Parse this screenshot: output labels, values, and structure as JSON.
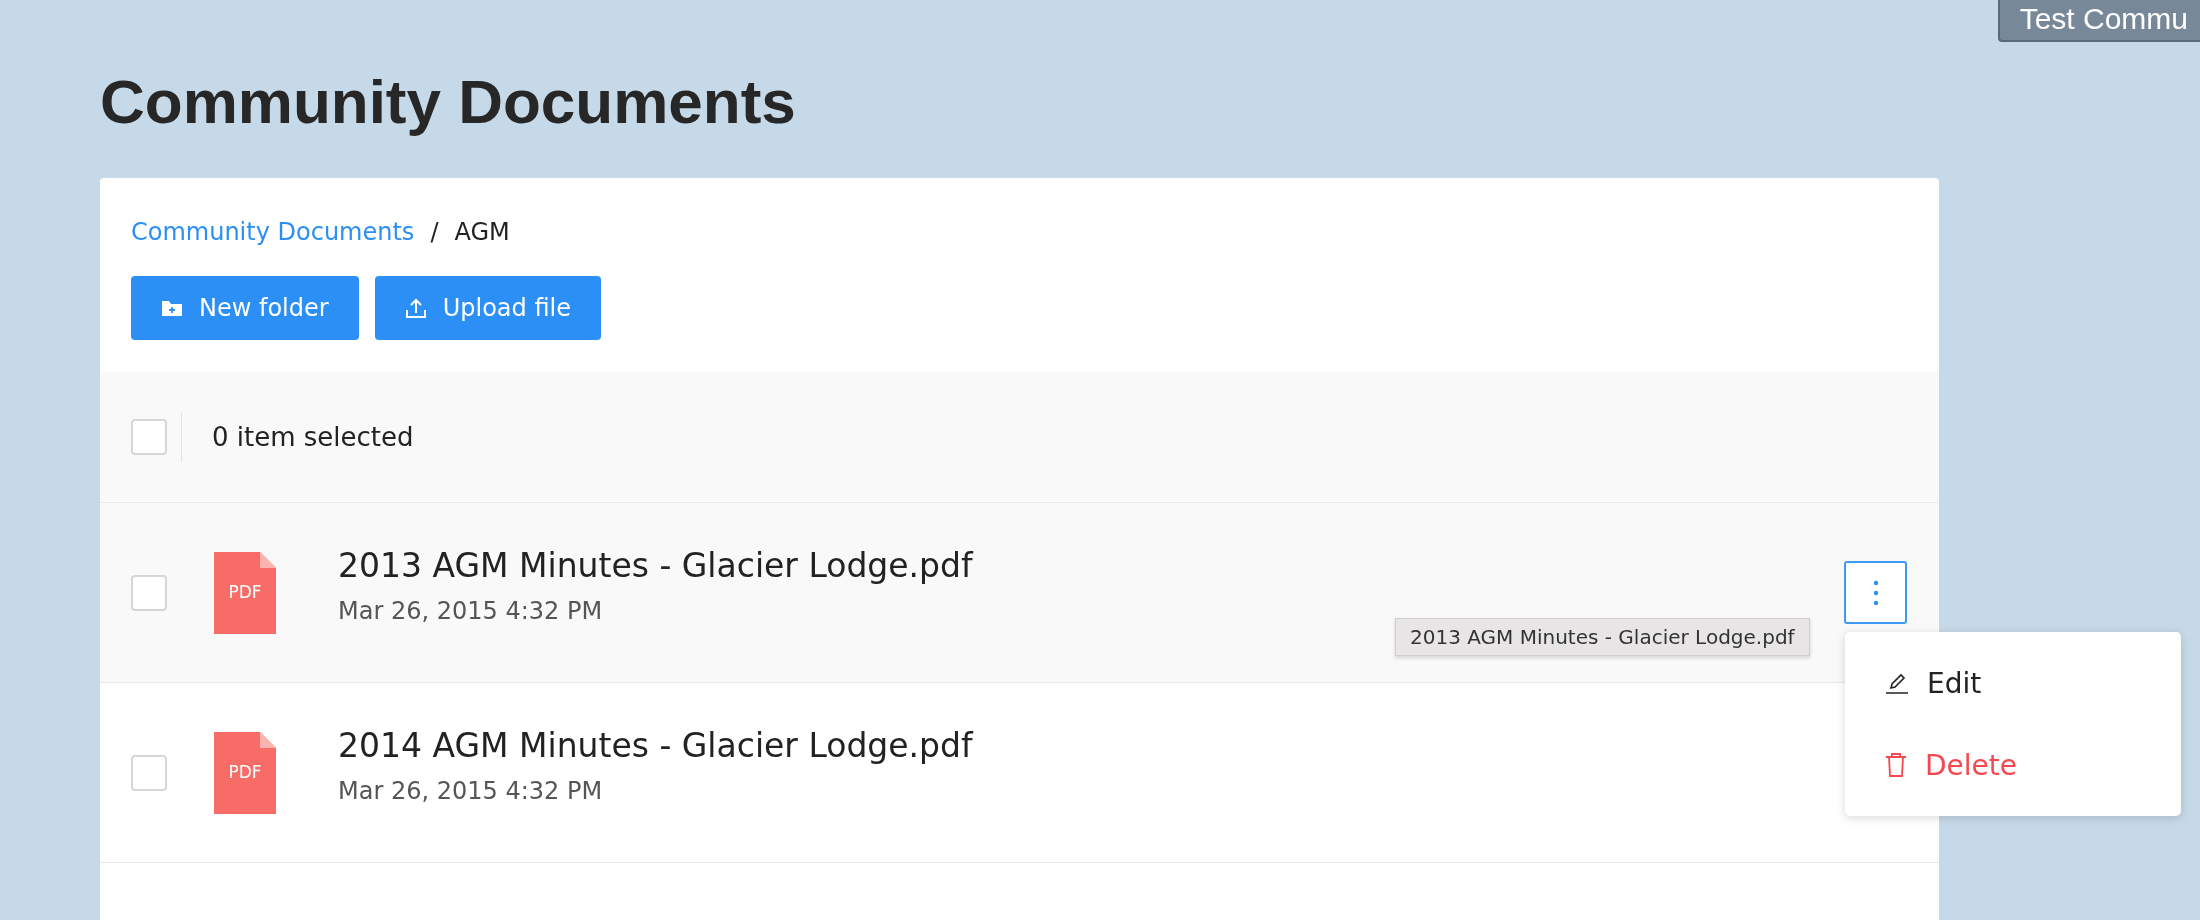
{
  "account_button": {
    "label": "Test Commu"
  },
  "page_title": "Community Documents",
  "breadcrumb": [
    {
      "label": "Community Documents",
      "kind": "link"
    },
    {
      "label": "AGM",
      "kind": "current"
    }
  ],
  "breadcrumb_separator": "/",
  "toolbar": [
    {
      "label": "New folder",
      "kind": "folder"
    },
    {
      "label": "Upload file",
      "kind": "upload"
    }
  ],
  "selection_bar": {
    "checked": false,
    "label": "0 item selected"
  },
  "files": [
    {
      "name": "2013 AGM Minutes - Glacier Lodge.pdf",
      "date": "Mar 26, 2015 4:32 PM",
      "type": "PDF",
      "checked": false,
      "highlighted": true,
      "menu_open": true
    },
    {
      "name": "2014 AGM Minutes - Glacier Lodge.pdf",
      "date": "Mar 26, 2015 4:32 PM",
      "type": "PDF",
      "checked": false,
      "highlighted": false,
      "menu_open": false
    }
  ],
  "tooltip": "2013 AGM Minutes - Glacier Lodge.pdf",
  "menu": [
    {
      "label": "Edit",
      "kind": "edit"
    },
    {
      "label": "Delete",
      "kind": "delete"
    }
  ]
}
